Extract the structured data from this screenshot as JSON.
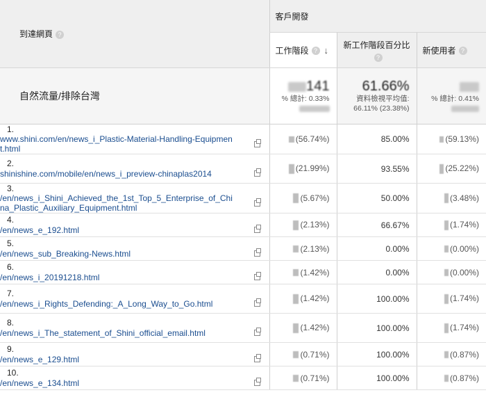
{
  "header": {
    "landing_page_label": "到達網頁",
    "group_label": "客戶開發",
    "col_sessions": "工作階段",
    "col_new_sessions_pct": "新工作階段百分比",
    "col_new_users": "新使用者"
  },
  "totals": {
    "label": "自然流量/排除台灣",
    "sessions_main": "141",
    "sessions_sub": "% 總計: 0.33%",
    "new_pct_main": "61.66%",
    "new_pct_sub1": "資料檢視平均值:",
    "new_pct_sub2": "66.11% (23.38%)",
    "new_users_sub": "% 總計: 0.41%"
  },
  "rows": [
    {
      "idx": "1.",
      "page": "www.shini.com/en/news_i_Plastic-Material-Handling-Equipment.html",
      "sessions": "(56.74%)",
      "new_pct": "85.00%",
      "new_users": "(59.13%)"
    },
    {
      "idx": "2.",
      "page": "shinishine.com/mobile/en/news_i_preview-chinaplas2014",
      "sessions": "(21.99%)",
      "new_pct": "93.55%",
      "new_users": "(25.22%)"
    },
    {
      "idx": "3.",
      "page": "                 /en/news_i_Shini_Achieved_the_1st_Top_5_Enterprise_of_China_Plastic_Auxiliary_Equipment.html",
      "sessions": "(5.67%)",
      "new_pct": "50.00%",
      "new_users": "(3.48%)"
    },
    {
      "idx": "4.",
      "page": "                 /en/news_e_192.html",
      "sessions": "(2.13%)",
      "new_pct": "66.67%",
      "new_users": "(1.74%)"
    },
    {
      "idx": "5.",
      "page": "                 /en/news_sub_Breaking-News.html",
      "sessions": "(2.13%)",
      "new_pct": "0.00%",
      "new_users": "(0.00%)"
    },
    {
      "idx": "6.",
      "page": "                 /en/news_i_20191218.html",
      "sessions": "(1.42%)",
      "new_pct": "0.00%",
      "new_users": "(0.00%)"
    },
    {
      "idx": "7.",
      "page": "                 /en/news_i_Rights_Defending:_A_Long_Way_to_Go.html",
      "sessions": "(1.42%)",
      "new_pct": "100.00%",
      "new_users": "(1.74%)"
    },
    {
      "idx": "8.",
      "page": "                 /en/news_i_The_statement_of_Shini_official_email.html",
      "sessions": "(1.42%)",
      "new_pct": "100.00%",
      "new_users": "(1.74%)"
    },
    {
      "idx": "9.",
      "page": "                 /en/news_e_129.html",
      "sessions": "(0.71%)",
      "new_pct": "100.00%",
      "new_users": "(0.87%)"
    },
    {
      "idx": "10.",
      "page": "                 /en/news_e_134.html",
      "sessions": "(0.71%)",
      "new_pct": "100.00%",
      "new_users": "(0.87%)"
    }
  ]
}
